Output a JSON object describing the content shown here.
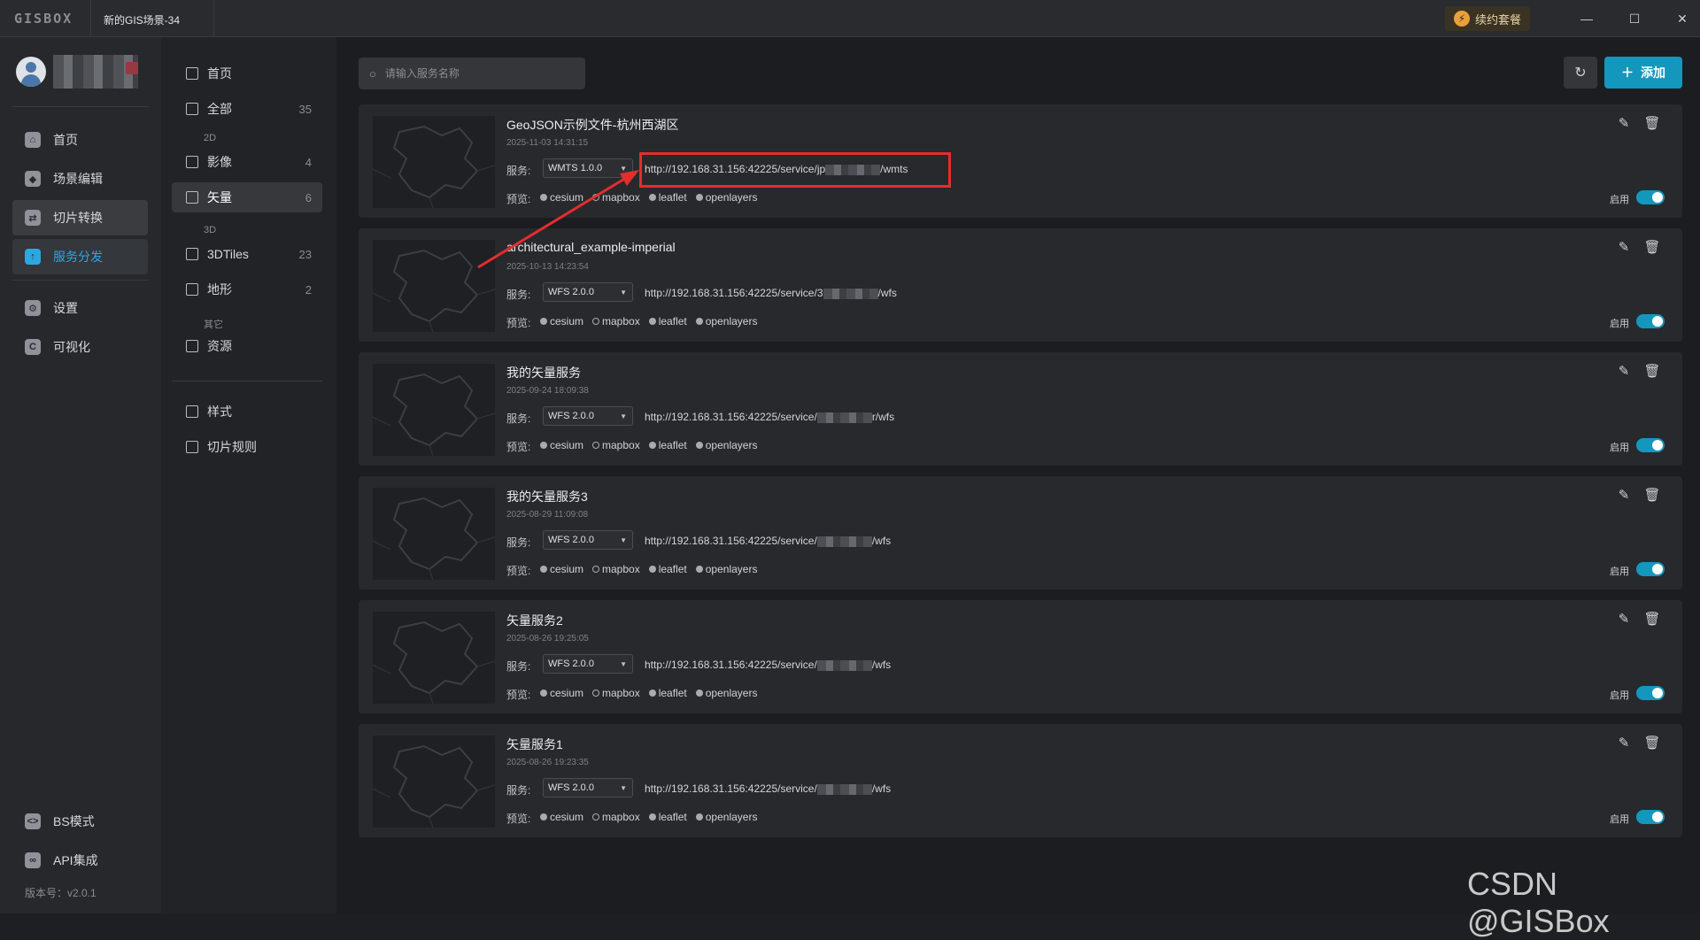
{
  "app": {
    "logo": "GISBOX",
    "scene_tab": "新的GIS场景-34",
    "renew_label": "续约套餐"
  },
  "sidebar": {
    "items": [
      {
        "label": "首页",
        "icon": "home-icon"
      },
      {
        "label": "场景编辑",
        "icon": "cube-icon"
      },
      {
        "label": "切片转换",
        "icon": "convert-icon"
      },
      {
        "label": "服务分发",
        "icon": "upload-cloud-icon"
      },
      {
        "label": "设置",
        "icon": "gear-icon"
      },
      {
        "label": "可视化",
        "icon": "visualize-icon"
      }
    ],
    "bottom": [
      {
        "label": "BS模式",
        "icon": "code-icon"
      },
      {
        "label": "API集成",
        "icon": "link-icon"
      }
    ],
    "version": "版本号：v2.0.1"
  },
  "subnav": {
    "home": "首页",
    "all": {
      "label": "全部",
      "count": "35"
    },
    "group_2d": "2D",
    "imagery": {
      "label": "影像",
      "count": "4"
    },
    "vector": {
      "label": "矢量",
      "count": "6"
    },
    "group_3d": "3D",
    "tiles3d": {
      "label": "3DTiles",
      "count": "23"
    },
    "terrain": {
      "label": "地形",
      "count": "2"
    },
    "group_other": "其它",
    "resources": {
      "label": "资源"
    },
    "styles": "样式",
    "tile_rules": "切片规则"
  },
  "toolbar": {
    "search_placeholder": "请输入服务名称",
    "add_label": "添加"
  },
  "labels": {
    "service": "服务:",
    "preview": "预览:",
    "enable": "启用",
    "previews": [
      "cesium",
      "mapbox",
      "leaflet",
      "openlayers"
    ]
  },
  "services": [
    {
      "title": "GeoJSON示例文件-杭州西湖区",
      "date": "2025-11-03 14:31:15",
      "version": "WMTS 1.0.0",
      "url_start": "http://192.168.31.156:42225/service/jp",
      "url_end": "/wmts",
      "enabled": true
    },
    {
      "title": "architectural_example-imperial",
      "date": "2025-10-13 14:23:54",
      "version": "WFS 2.0.0",
      "url_start": "http://192.168.31.156:42225/service/3",
      "url_end": "/wfs",
      "enabled": true
    },
    {
      "title": "我的矢量服务",
      "date": "2025-09-24 18:09:38",
      "version": "WFS 2.0.0",
      "url_start": "http://192.168.31.156:42225/service/",
      "url_end": "r/wfs",
      "enabled": true
    },
    {
      "title": "我的矢量服务3",
      "date": "2025-08-29 11:09:08",
      "version": "WFS 2.0.0",
      "url_start": "http://192.168.31.156:42225/service/",
      "url_end": "/wfs",
      "enabled": true
    },
    {
      "title": "矢量服务2",
      "date": "2025-08-26 19:25:05",
      "version": "WFS 2.0.0",
      "url_start": "http://192.168.31.156:42225/service/",
      "url_end": "/wfs",
      "enabled": true
    },
    {
      "title": "矢量服务1",
      "date": "2025-08-26 19:23:35",
      "version": "WFS 2.0.0",
      "url_start": "http://192.168.31.156:42225/service/",
      "url_end": "/wfs",
      "enabled": true
    }
  ],
  "watermark": "CSDN @GISBox",
  "colors": {
    "accent": "#1497bd",
    "annotation": "#e52d2d"
  }
}
